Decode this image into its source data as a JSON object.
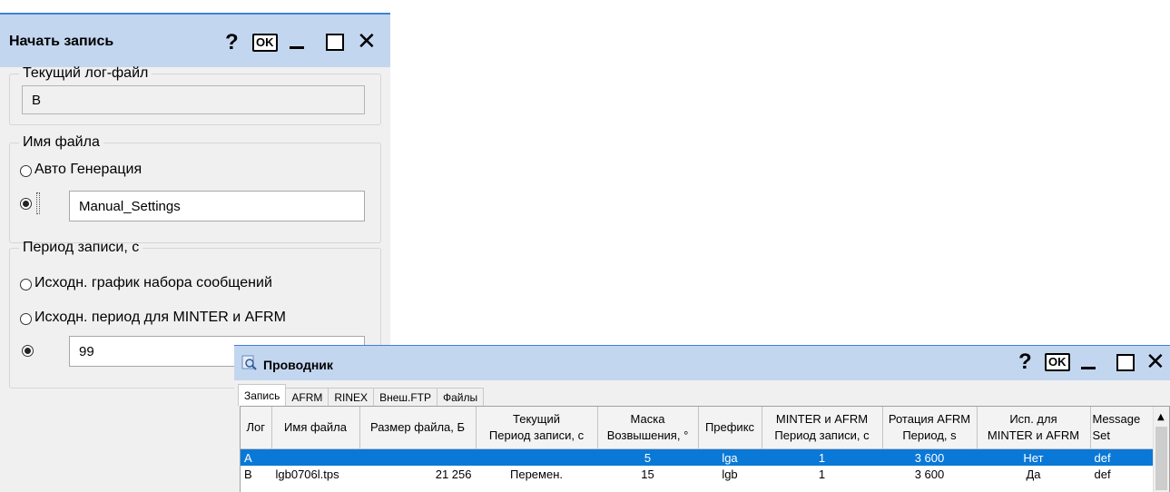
{
  "dialog1": {
    "title": "Начать запись",
    "buttons": {
      "help": "?",
      "ok": "OK",
      "close": "✕"
    },
    "current_log": {
      "legend": "Текущий лог-файл",
      "value": "B"
    },
    "filename": {
      "legend": "Имя файла",
      "auto_label": "Авто Генерация",
      "auto_selected": false,
      "manual_selected": true,
      "manual_value": "Manual_Settings"
    },
    "period": {
      "legend": "Период записи, с",
      "option1": "Исходн. график набора сообщений",
      "option2": "Исходн. период для MINTER и AFRM",
      "custom_value": "99",
      "custom_selected": true
    }
  },
  "dialog2": {
    "title": "Проводник",
    "buttons": {
      "help": "?",
      "ok": "OK",
      "close": "✕"
    },
    "tabs": [
      "Запись",
      "AFRM",
      "RINEX",
      "Внеш.FTP",
      "Файлы"
    ],
    "active_tab": "Запись",
    "columns": [
      {
        "l1": "Лог",
        "l2": ""
      },
      {
        "l1": "Имя файла",
        "l2": ""
      },
      {
        "l1": "Размер файла, Б",
        "l2": ""
      },
      {
        "l1": "Текущий",
        "l2": "Период записи, с"
      },
      {
        "l1": "Маска",
        "l2": "Возвышения, °"
      },
      {
        "l1": "Префикс",
        "l2": ""
      },
      {
        "l1": "MINTER и AFRM",
        "l2": "Период записи, с"
      },
      {
        "l1": "Ротация AFRM",
        "l2": "Период, s"
      },
      {
        "l1": "Исп. для",
        "l2": "MINTER и AFRM"
      },
      {
        "l1": "Message",
        "l2": "Set"
      }
    ],
    "rows": [
      {
        "log": "A",
        "file": "",
        "size": "",
        "period": "",
        "mask": "5",
        "prefix": "lga",
        "minter": "1",
        "rotation": "3 600",
        "use": "Нет",
        "msgset": "def",
        "selected": true
      },
      {
        "log": "B",
        "file": "lgb0706l.tps",
        "size": "21 256",
        "period": "Перемен.",
        "mask": "15",
        "prefix": "lgb",
        "minter": "1",
        "rotation": "3 600",
        "use": "Да",
        "msgset": "def",
        "selected": false
      }
    ]
  }
}
